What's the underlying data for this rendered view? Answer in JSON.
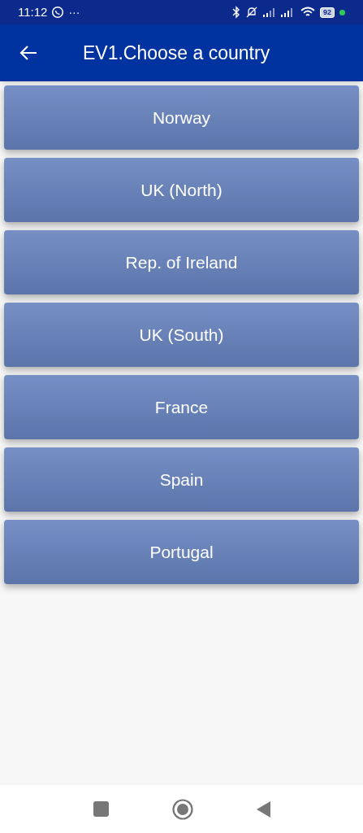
{
  "status_bar": {
    "time": "11:12",
    "more": "···",
    "battery": "92"
  },
  "app_bar": {
    "title": "EV1.Choose a country"
  },
  "countries": [
    {
      "label": "Norway"
    },
    {
      "label": "UK (North)"
    },
    {
      "label": "Rep. of Ireland"
    },
    {
      "label": "UK (South)"
    },
    {
      "label": "France"
    },
    {
      "label": "Spain"
    },
    {
      "label": "Portugal"
    }
  ]
}
